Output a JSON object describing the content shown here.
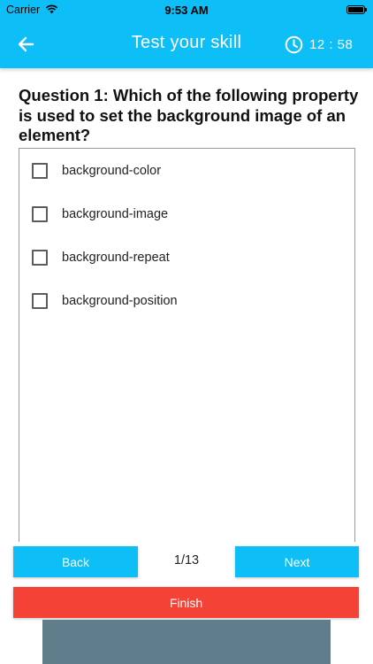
{
  "status_bar": {
    "carrier": "Carrier",
    "time": "9:53 AM"
  },
  "app_bar": {
    "title": "Test your skill",
    "timer": "12 : 58",
    "color": "#0EBEF7"
  },
  "question": {
    "text": "Question 1: Which of the following property is used to set the background image of an element?"
  },
  "options": [
    {
      "label": "background-color",
      "checked": false
    },
    {
      "label": "background-image",
      "checked": false
    },
    {
      "label": "background-repeat",
      "checked": false
    },
    {
      "label": "background-position",
      "checked": false
    }
  ],
  "navigation": {
    "back_label": "Back",
    "next_label": "Next",
    "page_indicator": "1/13",
    "finish_label": "Finish"
  },
  "colors": {
    "primary": "#0EBEF7",
    "finish": "#F44336",
    "banner": "#607D8B"
  }
}
